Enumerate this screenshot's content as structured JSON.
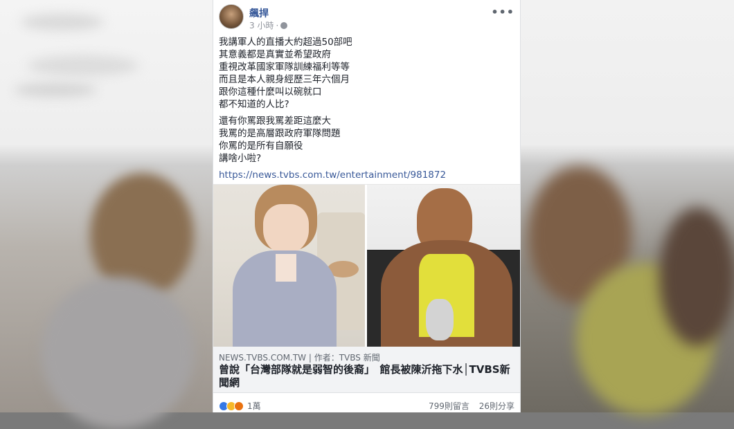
{
  "post": {
    "author": "飆捍",
    "time": "3 小時",
    "separator": "·",
    "more_label": "•••",
    "paragraph1": [
      "我講軍人的直播大約超過50部吧",
      "其意義都是真實並希望政府",
      "重視改革國家軍隊訓練福利等等",
      "而且是本人親身經歷三年六個月",
      "跟你這種什麼叫以碗就口",
      "都不知道的人比?"
    ],
    "paragraph2": [
      "還有你罵跟我罵差距這麼大",
      "我罵的是高層跟政府軍隊問題",
      "你罵的是所有自願役",
      "講啥小啦?"
    ],
    "link": "https://news.tvbs.com.tw/entertainment/981872"
  },
  "preview": {
    "domain": "NEWS.TVBS.COM.TW | 作者：TVBS 新聞",
    "headline": "曾說「台灣部隊就是弱智的後裔」　館長被陳沂拖下水│TVBS新聞網"
  },
  "footer": {
    "reactions_count": "1萬",
    "comments": "799則留言",
    "shares": "26則分享"
  },
  "icons": {
    "reactions": [
      "like-icon",
      "haha-icon",
      "angry-icon"
    ],
    "globe": "globe-icon"
  },
  "colors": {
    "author": "#365899",
    "link": "#385898",
    "caption_bg": "#f2f3f5"
  }
}
